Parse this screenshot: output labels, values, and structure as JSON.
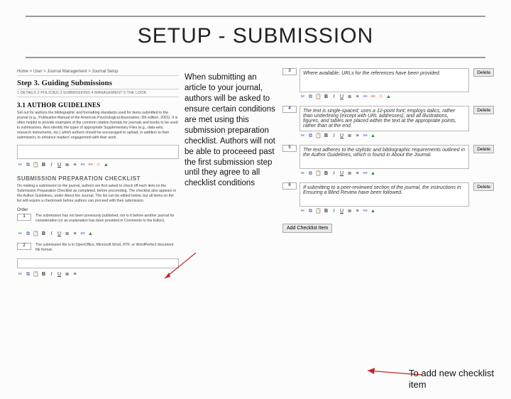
{
  "title": "SETUP - SUBMISSION",
  "breadcrumb": "Home > User > Journal Management > Journal Setup",
  "step_title": "Step 3. Guiding Submissions",
  "subnav": "1 DETAILS  2 POLICIES  3 SUBMISSIONS  4 MANAGEMENT  5 THE LOOK",
  "left": {
    "authg_head": "3.1 AUTHOR GUIDELINES",
    "authg_body": "Set out for authors the bibliographic and formatting standards used for items submitted to the journal (e.g., Publication Manual of the American Psychological Association, 5th edition, 2001). It is often helpful to provide examples of the common citation formats for journals and books to be used in submissions. Also identify the types of appropriate Supplementary Files (e.g., data-sets, research instruments, etc.) which authors should be encouraged to upload, in addition to their submission, to enhance readers' engagement with their work.",
    "spc_head": "SUBMISSION PREPARATION CHECKLIST",
    "spc_body": "On making a submission to the journal, authors are first asked to check off each item on the Submission Preparation Checklist as completed, before proceeding. The checklist also appears in the Author Guidelines, under About the Journal. The list can be edited below, but all items on the list will require a checkmark before authors can proceed with their submission.",
    "order_label": "Order",
    "items": [
      {
        "n": "1",
        "text": "The submission has not been previously published, nor is it before another journal for consideration (or an explanation has been provided in Comments to the Editor)."
      },
      {
        "n": "2",
        "text": "The submission file is in OpenOffice, Microsoft Word, RTF, or WordPerfect document file format."
      }
    ]
  },
  "mid_text": "When submitting an article to your journal, authors will be asked to ensure certain conditions are met using this submission preparation checklist. Authors will not be able to proceeed past the first submission step until they agree to all checklist conditions",
  "right": {
    "items": [
      {
        "n": "3",
        "text": "Where available, URLs for the references have been provided."
      },
      {
        "n": "4",
        "text": "The text is single-spaced; uses a 12-point font; employs italics, rather than underlining (except with URL addresses); and all illustrations, figures, and tables are placed within the text at the appropriate points, rather than at the end."
      },
      {
        "n": "5",
        "text": "The text adheres to the stylistic and bibliographic requirements outlined in the Author Guidelines, which is found in About the Journal."
      },
      {
        "n": "6",
        "text": "If submitting to a peer-reviewed section of the journal, the instructions in Ensuring a Blind Review have been followed."
      }
    ],
    "delete_label": "Delete",
    "add_label": "Add Checklist Item"
  },
  "right_caption": "To add new checklist item"
}
